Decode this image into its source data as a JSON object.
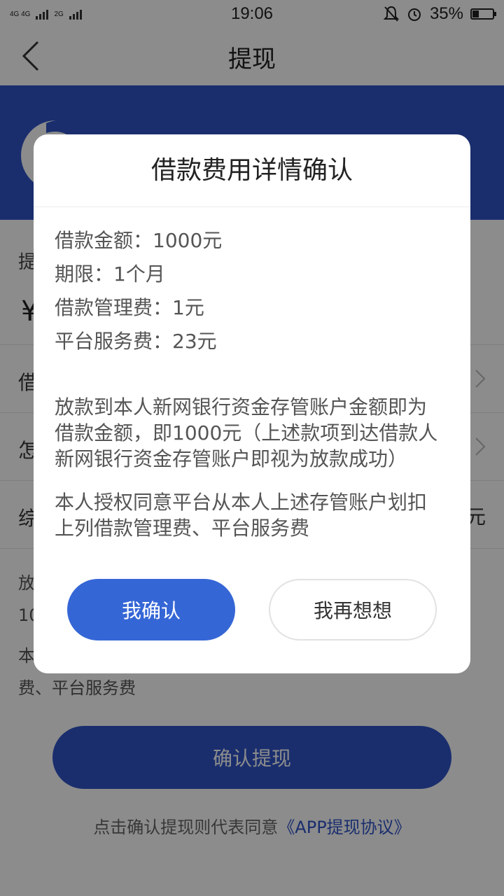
{
  "status_bar": {
    "network_1": "4G 4G",
    "network_2": "2G",
    "time": "19:06",
    "battery_percent": "35%",
    "battery_level": 0.35,
    "icons": [
      "mute-icon",
      "alarm-icon",
      "battery-icon"
    ]
  },
  "nav": {
    "title": "提现",
    "back_icon": "chevron-left-icon"
  },
  "page": {
    "withdraw_label": "提",
    "currency_symbol": "¥",
    "rows": [
      {
        "label": "借"
      },
      {
        "label": "怎"
      },
      {
        "label": "综",
        "value": "元"
      }
    ],
    "notice_line1": "放",
    "notice_line2": "10",
    "notice_line3": "本",
    "notice_line4": "费、平台服务费",
    "confirm_withdraw_button": "确认提现",
    "agreement_prefix": "点击确认提现则代表同意",
    "agreement_link": "《APP提现协议》"
  },
  "dialog": {
    "title": "借款费用详情确认",
    "lines": [
      "借款金额：1000元",
      "期限：1个月",
      "借款管理费：1元",
      "平台服务费：23元"
    ],
    "para1": [
      "放款到本人新网银行资金存管账户金额即为",
      "借款金额，即1000元（上述款项到达借款人",
      "新网银行资金存管账户即视为放款成功）"
    ],
    "para2": [
      "本人授权同意平台从本人上述存管账户划扣",
      "上列借款管理费、平台服务费"
    ],
    "confirm_button": "我确认",
    "reconsider_button": "我再想想"
  },
  "colors": {
    "brand_blue": "#3055c8",
    "confirm_blue": "#3566d6",
    "overlay": "rgba(0,0,0,0.45)"
  }
}
